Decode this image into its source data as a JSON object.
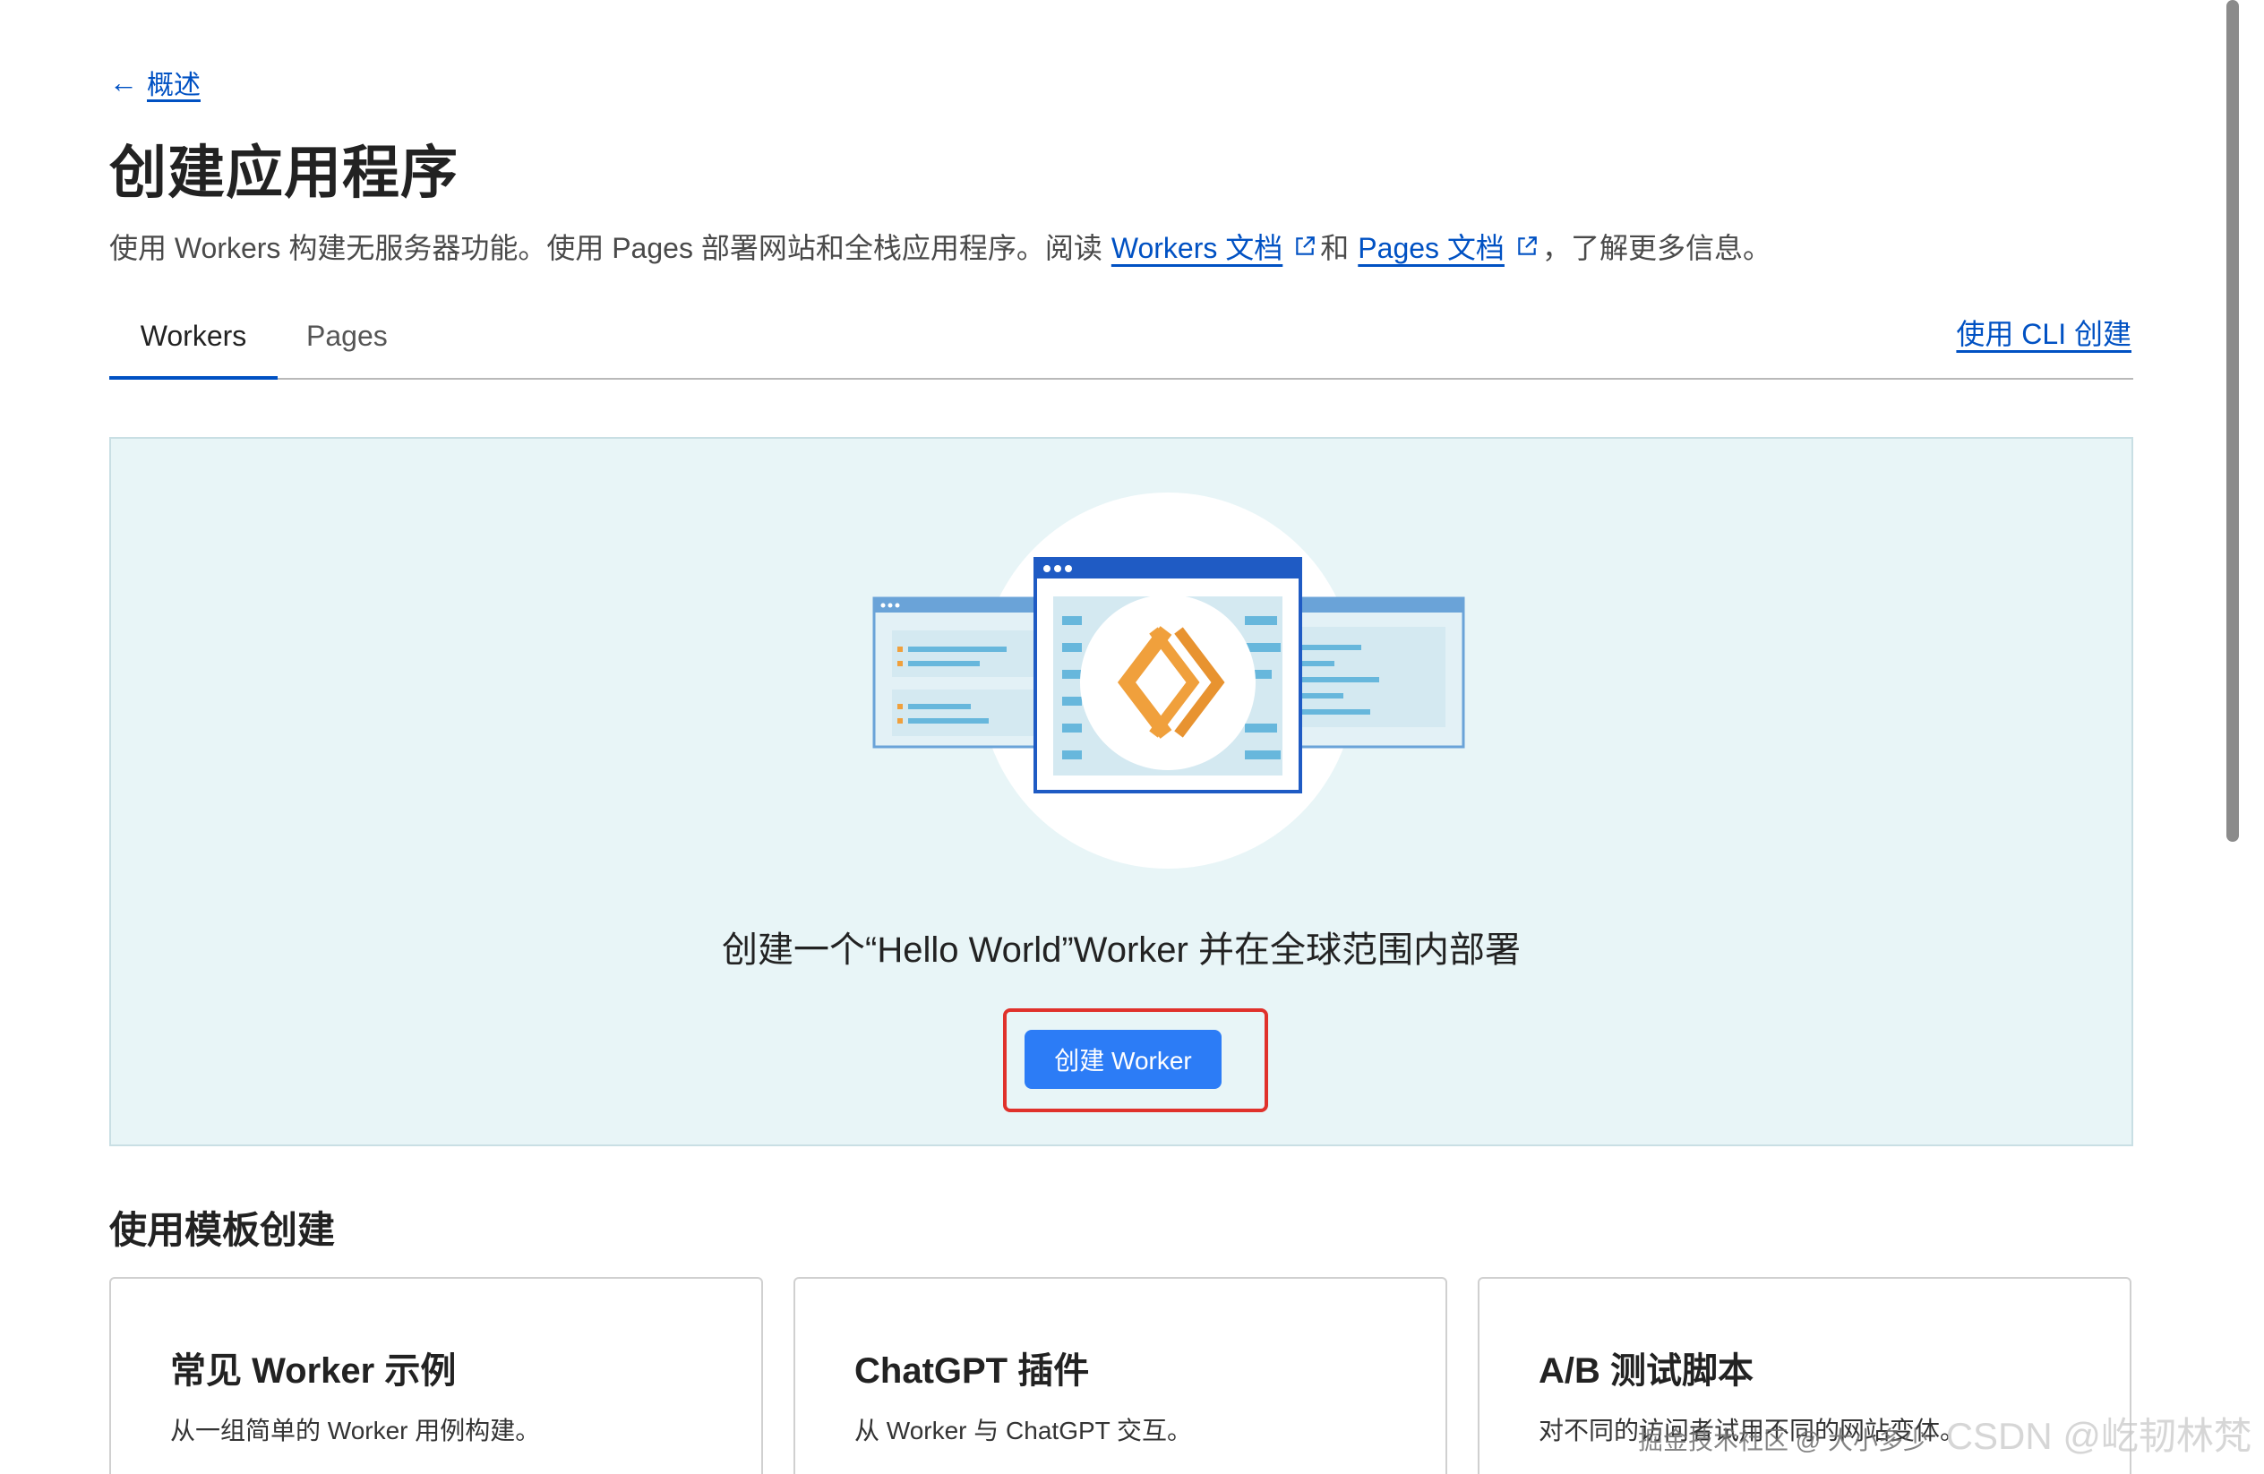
{
  "breadcrumb": {
    "back_label": "概述"
  },
  "page": {
    "title": "创建应用程序"
  },
  "subtitle": {
    "prefix": "使用 Workers 构建无服务器功能。使用 Pages 部署网站和全栈应用程序。阅读",
    "workers_docs_link": "Workers 文档",
    "connector": "和",
    "pages_docs_link": "Pages 文档",
    "suffix": "，了解更多信息。"
  },
  "tabs": [
    {
      "label": "Workers",
      "active": true
    },
    {
      "label": "Pages",
      "active": false
    }
  ],
  "cli_link": "使用 CLI 创建",
  "hero": {
    "text": "创建一个“Hello World”Worker 并在全球范围内部署",
    "button_label": "创建 Worker"
  },
  "templates": {
    "title": "使用模板创建",
    "cards": [
      {
        "title": "常见 Worker 示例",
        "description": "从一组简单的 Worker 用例构建。"
      },
      {
        "title": "ChatGPT 插件",
        "description": "从 Worker 与 ChatGPT 交互。"
      },
      {
        "title": "A/B 测试脚本",
        "description": "对不同的访问者试用不同的网站变体。"
      }
    ]
  },
  "watermark": {
    "small": "掘金技术社区 @ 大小多少",
    "large": "CSDN @屹韧林梵"
  },
  "colors": {
    "link": "#0051c3",
    "button": "#2c7cf6",
    "hero_bg": "#e8f5f7",
    "highlight": "#e0312b",
    "accent_orange": "#f0a03c"
  }
}
